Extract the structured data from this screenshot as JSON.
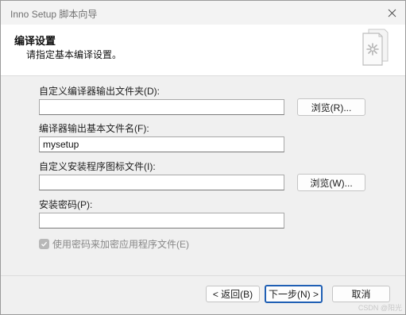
{
  "window": {
    "title": "Inno Setup 脚本向导",
    "close_icon": "close-icon"
  },
  "header": {
    "title": "编译设置",
    "subtitle": "请指定基本编译设置。",
    "icon": "document-gear-icon"
  },
  "fields": {
    "output_folder": {
      "label": "自定义编译器输出文件夹(D):",
      "value": "",
      "browse_label": "浏览(R)..."
    },
    "base_filename": {
      "label": "编译器输出基本文件名(F):",
      "value": "mysetup"
    },
    "setup_icon": {
      "label": "自定义安装程序图标文件(I):",
      "value": "",
      "browse_label": "浏览(W)..."
    },
    "password": {
      "label": "安装密码(P):",
      "value": ""
    },
    "encrypt": {
      "label": "使用密码来加密应用程序文件(E)",
      "checked": true,
      "enabled": false
    }
  },
  "footer": {
    "back_label": "< 返回(B)",
    "next_label": "下一步(N) >",
    "cancel_label": "取消"
  },
  "watermark": "CSDN @阳光",
  "colors": {
    "accent": "#1f5fb4",
    "window_bg": "#f0f0f0",
    "header_bg": "#ffffff",
    "disabled_text": "#888888"
  }
}
